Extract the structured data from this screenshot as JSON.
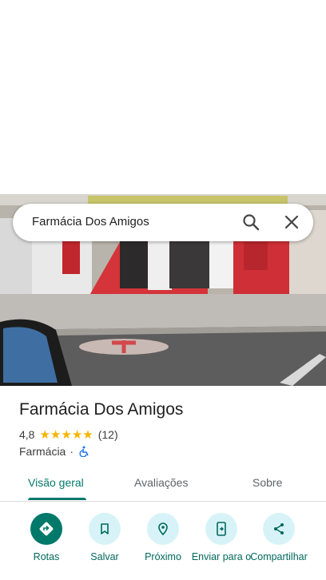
{
  "search": {
    "query": "Farmácia Dos Amigos"
  },
  "place": {
    "name": "Farmácia Dos Amigos",
    "rating": "4,8",
    "stars": 5,
    "review_count": "(12)",
    "category": "Farmácia",
    "separator": "·"
  },
  "tabs": [
    {
      "label": "Visão geral",
      "active": true
    },
    {
      "label": "Avaliações",
      "active": false
    },
    {
      "label": "Sobre",
      "active": false
    }
  ],
  "actions": [
    {
      "label": "Rotas",
      "icon": "directions-icon"
    },
    {
      "label": "Salvar",
      "icon": "bookmark-icon"
    },
    {
      "label": "Próximo",
      "icon": "nearby-icon"
    },
    {
      "label": "Enviar para o",
      "icon": "send-to-phone-icon"
    },
    {
      "label": "Compartilhar",
      "icon": "share-icon"
    }
  ],
  "colors": {
    "accent": "#00796b",
    "action_bg": "#d7f3f7",
    "star": "#f4b400"
  }
}
